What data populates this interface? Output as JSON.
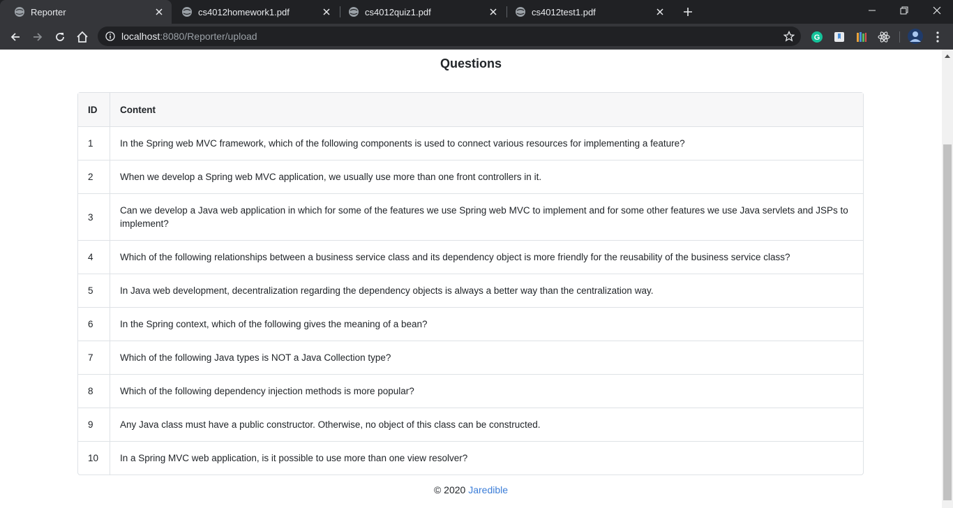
{
  "browser": {
    "tabs": [
      {
        "title": "Reporter",
        "active": true
      },
      {
        "title": "cs4012homework1.pdf",
        "active": false
      },
      {
        "title": "cs4012quiz1.pdf",
        "active": false
      },
      {
        "title": "cs4012test1.pdf",
        "active": false
      }
    ],
    "address": {
      "host": "localhost",
      "rest": ":8080/Reporter/upload"
    },
    "extensions": [
      "grammarly-icon",
      "bookmark-ext-icon",
      "library-icon",
      "react-devtools-icon",
      "profile-avatar"
    ]
  },
  "page": {
    "title": "Questions",
    "table": {
      "headers": {
        "id": "ID",
        "content": "Content"
      },
      "rows": [
        {
          "id": "1",
          "content": "In the Spring web MVC framework, which of the following components is used to connect various resources for implementing a feature?"
        },
        {
          "id": "2",
          "content": "When we develop a Spring web MVC application, we usually use more than one front controllers in it."
        },
        {
          "id": "3",
          "content": "Can we develop a Java web application in which for some of the features we use Spring web MVC to implement and for some other features we use Java servlets and JSPs to implement?"
        },
        {
          "id": "4",
          "content": "Which of the following relationships between a business service class and its dependency object is more friendly for the reusability of the business service class?"
        },
        {
          "id": "5",
          "content": "In Java web development, decentralization regarding the dependency objects is always a better way than the centralization way."
        },
        {
          "id": "6",
          "content": "In the Spring context, which of the following gives the meaning of a bean?"
        },
        {
          "id": "7",
          "content": "Which of the following Java types is NOT a Java Collection type?"
        },
        {
          "id": "8",
          "content": "Which of the following dependency injection methods is more popular?"
        },
        {
          "id": "9",
          "content": "Any Java class must have a public constructor. Otherwise, no object of this class can be constructed."
        },
        {
          "id": "10",
          "content": "In a Spring MVC web application, is it possible to use more than one view resolver?"
        }
      ]
    },
    "footer": {
      "copyright": "© 2020",
      "link": "Jaredible"
    }
  },
  "colors": {
    "chrome_dark": "#202124",
    "chrome_toolbar": "#35363a",
    "link": "#3b7dd8"
  }
}
